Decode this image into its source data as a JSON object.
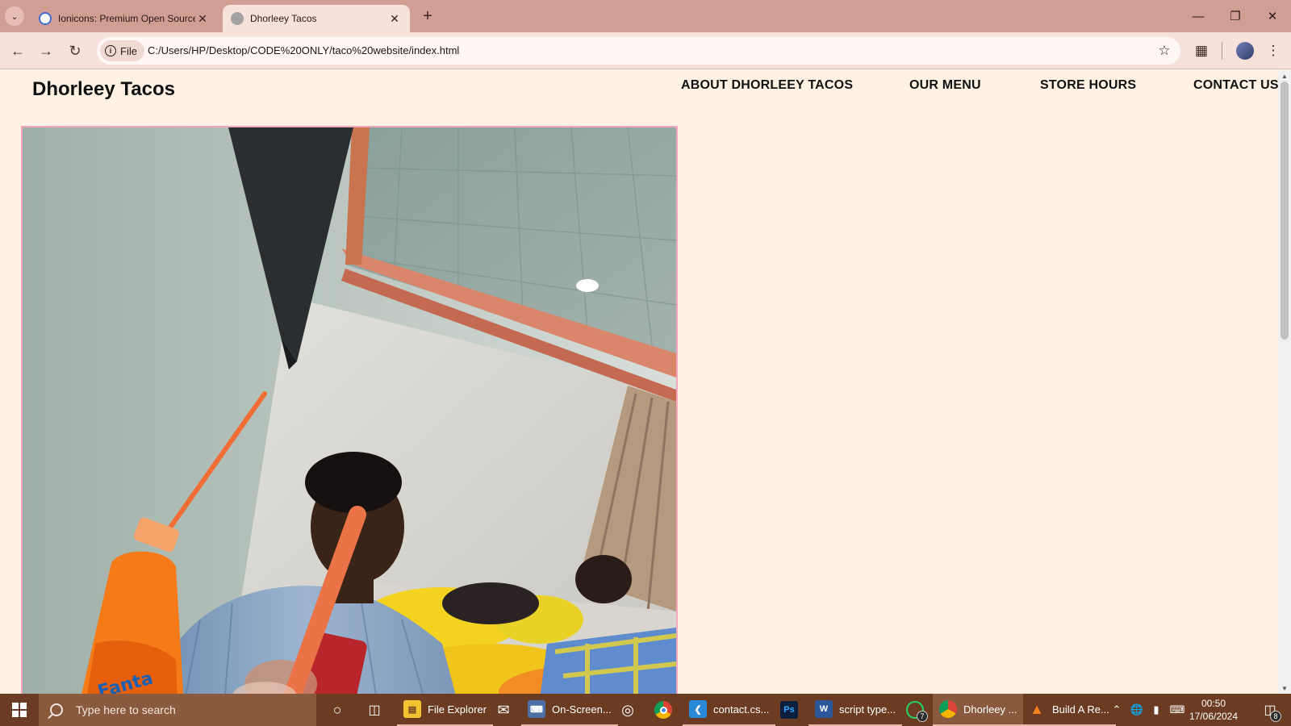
{
  "browser": {
    "tabs": [
      {
        "title": "Ionicons: Premium Open Source",
        "active": false
      },
      {
        "title": "Dhorleey Tacos",
        "active": true
      }
    ],
    "address": {
      "scheme_label": "File",
      "url": "C:/Users/HP/Desktop/CODE%20ONLY/taco%20website/index.html"
    }
  },
  "site": {
    "logo": "Dhorleey Tacos",
    "nav": [
      "ABOUT DHORLEEY TACOS",
      "OUR MENU",
      "STORE HOURS",
      "CONTACT US"
    ]
  },
  "taskbar": {
    "search_placeholder": "Type here to search",
    "apps": [
      {
        "label": "File Explorer"
      },
      {
        "label": "On-Screen..."
      },
      {
        "label": "contact.cs..."
      },
      {
        "label": "script type..."
      },
      {
        "label": "Dhorleey ..."
      },
      {
        "label": "Build A Re..."
      }
    ],
    "whatsapp_badge": "7",
    "notification_count": "8",
    "clock": {
      "time": "00:50",
      "date": "17/06/2024"
    }
  },
  "colors": {
    "page_background": "#fff1e3",
    "tabstrip": "#d19e94",
    "image_border": "#f3a6bc",
    "taskbar": "#6b3c22"
  }
}
